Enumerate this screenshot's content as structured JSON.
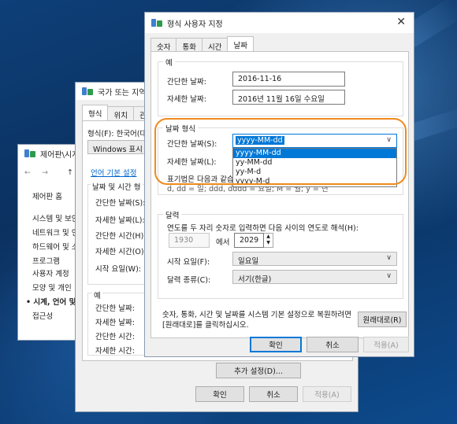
{
  "control_panel": {
    "title": "제어판\\시계",
    "nav_arrows": [
      "←",
      "→",
      "↑"
    ],
    "items": [
      "제어판 홈",
      "시스템 및 보안",
      "네트워크 및 인",
      "하드웨어 및 소",
      "프로그램",
      "사용자 계정",
      "모양 및 개인",
      "• 시계, 언어 및",
      "접근성"
    ]
  },
  "region": {
    "title": "국가 또는 지역",
    "tabs": [
      "형식",
      "위치",
      "관"
    ],
    "format_label": "형식(F): 한국어(대",
    "format_value": "Windows 표시 언",
    "language_link": "언어 기본 설정",
    "section_title": "날짜 및 시간 형",
    "rows": [
      "간단한 날짜(S):",
      "자세한 날짜(L):",
      "간단한 시간(H):",
      "자세한 시간(O):",
      "시작 요일(W):"
    ],
    "example_title": "예",
    "example_rows": [
      "간단한 날짜:",
      "자세한 날짜:",
      "간단한 시간:",
      "자세한 시간:"
    ],
    "additional_button": "추가 설정(D)...",
    "ok": "확인",
    "cancel": "취소",
    "apply": "적용(A)"
  },
  "custom": {
    "title": "형식 사용자 지정",
    "tabs": [
      "숫자",
      "통화",
      "시간",
      "날짜"
    ],
    "example_group": "예",
    "short_date_label": "간단한 날짜:",
    "short_date_value": "2016-11-16",
    "long_date_label": "자세한 날짜:",
    "long_date_value": "2016년 11월 16일 수요일",
    "date_format_group": "날짜 형식",
    "short_date_fmt_label": "간단한 날짜(S):",
    "short_date_fmt_value": "yyyy-MM-dd",
    "long_date_fmt_label": "자세한 날짜(L):",
    "notation_label": "표기법은 다음과 같습니",
    "notation_rest": "d, dd = 일; ddd, dddd = 요일; M = 월; y = 년",
    "dropdown_options": [
      "yyyy-MM-dd",
      "yy-MM-dd",
      "yy-M-d",
      "yyyy-M-d"
    ],
    "calendar_group": "달력",
    "two_digit_text": "연도를 두 자리 숫자로 입력하면 다음 사이의 연도로 해석(H):",
    "year_from": "1930",
    "year_to_label": "에서",
    "year_to": "2029",
    "first_day_label": "시작 요일(F):",
    "first_day_value": "일요일",
    "calendar_type_label": "달력 종류(C):",
    "calendar_type_value": "서기(한글)",
    "reset_text_1": "숫자, 통화, 시간 및 날짜를 시스템 기본 설정으로 복원하려면",
    "reset_text_2": "[원래대로]를 클릭하십시오.",
    "reset_button": "원래대로(R)",
    "ok": "확인",
    "cancel": "취소",
    "apply": "적용(A)"
  },
  "colors": {
    "accent": "#0078d7",
    "highlight": "#f08a1c"
  }
}
